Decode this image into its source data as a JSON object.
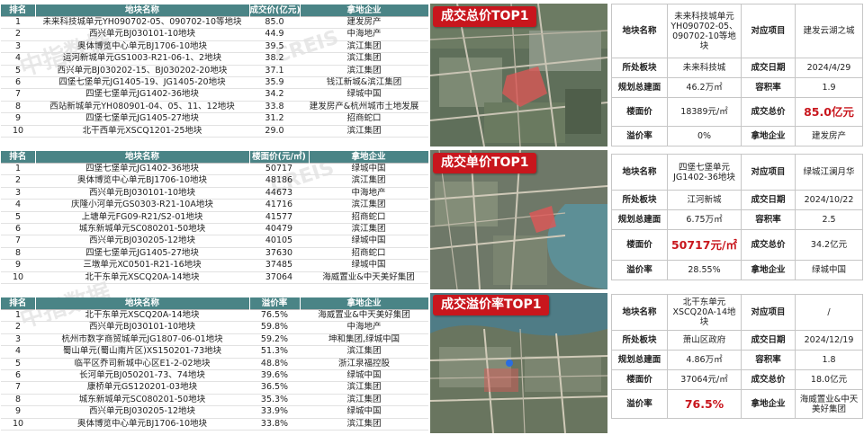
{
  "watermark": {
    "cn": "中指数据",
    "en": "CREIS"
  },
  "columns": {
    "total": [
      "排名",
      "地块名称",
      "成交价(亿元)",
      "拿地企业"
    ],
    "unit": [
      "排名",
      "地块名称",
      "楼面价(元/㎡)",
      "拿地企业"
    ],
    "premium": [
      "排名",
      "地块名称",
      "溢价率",
      "拿地企业"
    ]
  },
  "total_rows": [
    {
      "rank": "1",
      "name": "未来科技城单元YH090702-05、090702-10等地块",
      "value": "85.0",
      "company": "建发房产"
    },
    {
      "rank": "2",
      "name": "西兴单元BJ030101-10地块",
      "value": "44.9",
      "company": "中海地产"
    },
    {
      "rank": "3",
      "name": "奥体博览中心单元BJ1706-10地块",
      "value": "39.5",
      "company": "滨江集团"
    },
    {
      "rank": "4",
      "name": "运河新城单元GS1003-R21-06-1、2地块",
      "value": "38.2",
      "company": "滨江集团"
    },
    {
      "rank": "5",
      "name": "西兴单元BJ030202-15、BJ030202-20地块",
      "value": "37.1",
      "company": "滨江集团"
    },
    {
      "rank": "6",
      "name": "四堡七堡单元JG1405-19、JG1405-20地块",
      "value": "35.9",
      "company": "钱江新城&滨江集团"
    },
    {
      "rank": "7",
      "name": "四堡七堡单元JG1402-36地块",
      "value": "34.2",
      "company": "绿城中国"
    },
    {
      "rank": "8",
      "name": "西站新城单元YH080901-04、05、11、12地块",
      "value": "33.8",
      "company": "建发房产&杭州城市土地发展"
    },
    {
      "rank": "9",
      "name": "四堡七堡单元JG1405-27地块",
      "value": "31.2",
      "company": "招商蛇口"
    },
    {
      "rank": "10",
      "name": "北干西单元XSCQ1201-25地块",
      "value": "29.0",
      "company": "滨江集团"
    }
  ],
  "unit_rows": [
    {
      "rank": "1",
      "name": "四堡七堡单元JG1402-36地块",
      "value": "50717",
      "company": "绿城中国"
    },
    {
      "rank": "2",
      "name": "奥体博览中心单元BJ1706-10地块",
      "value": "48186",
      "company": "滨江集团"
    },
    {
      "rank": "3",
      "name": "西兴单元BJ030101-10地块",
      "value": "44673",
      "company": "中海地产"
    },
    {
      "rank": "4",
      "name": "庆隆小河单元GS0303-R21-10A地块",
      "value": "41716",
      "company": "滨江集团"
    },
    {
      "rank": "5",
      "name": "上塘单元FG09-R21/S2-01地块",
      "value": "41577",
      "company": "招商蛇口"
    },
    {
      "rank": "6",
      "name": "城东新城单元SC080201-50地块",
      "value": "40479",
      "company": "滨江集团"
    },
    {
      "rank": "7",
      "name": "西兴单元BJ030205-12地块",
      "value": "40105",
      "company": "绿城中国"
    },
    {
      "rank": "8",
      "name": "四堡七堡单元JG1405-27地块",
      "value": "37630",
      "company": "招商蛇口"
    },
    {
      "rank": "9",
      "name": "三墩单元XC0501-R21-16地块",
      "value": "37485",
      "company": "绿城中国"
    },
    {
      "rank": "10",
      "name": "北干东单元XSCQ20A-14地块",
      "value": "37064",
      "company": "海威置业&中天美好集团"
    }
  ],
  "premium_rows": [
    {
      "rank": "1",
      "name": "北干东单元XSCQ20A-14地块",
      "value": "76.5%",
      "company": "海威置业&中天美好集团"
    },
    {
      "rank": "2",
      "name": "西兴单元BJ030101-10地块",
      "value": "59.8%",
      "company": "中海地产"
    },
    {
      "rank": "3",
      "name": "杭州市数字商贸城单元JG1807-06-01地块",
      "value": "59.2%",
      "company": "坤和集团,绿城中国"
    },
    {
      "rank": "4",
      "name": "蜀山单元(蜀山南片区)XS150201-73地块",
      "value": "51.3%",
      "company": "滨江集团"
    },
    {
      "rank": "5",
      "name": "临平区乔司新城中心区E1-2-02地块",
      "value": "48.8%",
      "company": "浙江泉福控股"
    },
    {
      "rank": "6",
      "name": "长河单元BJ050201-73、74地块",
      "value": "39.6%",
      "company": "绿城中国"
    },
    {
      "rank": "7",
      "name": "康桥单元GS120201-03地块",
      "value": "36.5%",
      "company": "滨江集团"
    },
    {
      "rank": "8",
      "name": "城东新城单元SC080201-50地块",
      "value": "35.3%",
      "company": "滨江集团"
    },
    {
      "rank": "9",
      "name": "西兴单元BJ030205-12地块",
      "value": "33.9%",
      "company": "绿城中国"
    },
    {
      "rank": "10",
      "name": "奥体博览中心单元BJ1706-10地块",
      "value": "33.8%",
      "company": "滨江集团"
    }
  ],
  "banners": {
    "total": "成交总价TOP1",
    "unit": "成交单价TOP1",
    "premium": "成交溢价率TOP1"
  },
  "labels": {
    "name": "地块名称",
    "project": "对应项目",
    "plate": "所处板块",
    "date": "成交日期",
    "area": "规划总建面",
    "far": "容积率",
    "floor_price": "楼面价",
    "total_price": "成交总价",
    "premium": "溢价率",
    "company": "拿地企业"
  },
  "detail_total": {
    "name": "未来科技城单元YH090702-05、090702-10等地块",
    "project": "建发云湖之城",
    "plate": "未来科技城",
    "date": "2024/4/29",
    "area": "46.2万㎡",
    "far": "1.9",
    "floor_price": "18389元/㎡",
    "total_price": "85.0亿元",
    "premium": "0%",
    "company": "建发房产"
  },
  "detail_unit": {
    "name": "四堡七堡单元JG1402-36地块",
    "project": "绿城江澜月华",
    "plate": "江河新城",
    "date": "2024/10/22",
    "area": "6.75万㎡",
    "far": "2.5",
    "floor_price": "50717元/㎡",
    "total_price": "34.2亿元",
    "premium": "28.55%",
    "company": "绿城中国"
  },
  "detail_premium": {
    "name": "北干东单元XSCQ20A-14地块",
    "project": "/",
    "plate": "萧山区政府",
    "date": "2024/12/19",
    "area": "4.86万㎡",
    "far": "1.8",
    "floor_price": "37064元/㎡",
    "total_price": "18.0亿元",
    "premium": "76.5%",
    "company": "海威置业&中天美好集团"
  },
  "colors": {
    "header_teal": "#4a8486",
    "banner_red": "#c8161d",
    "highlight_red": "#c8161d"
  }
}
